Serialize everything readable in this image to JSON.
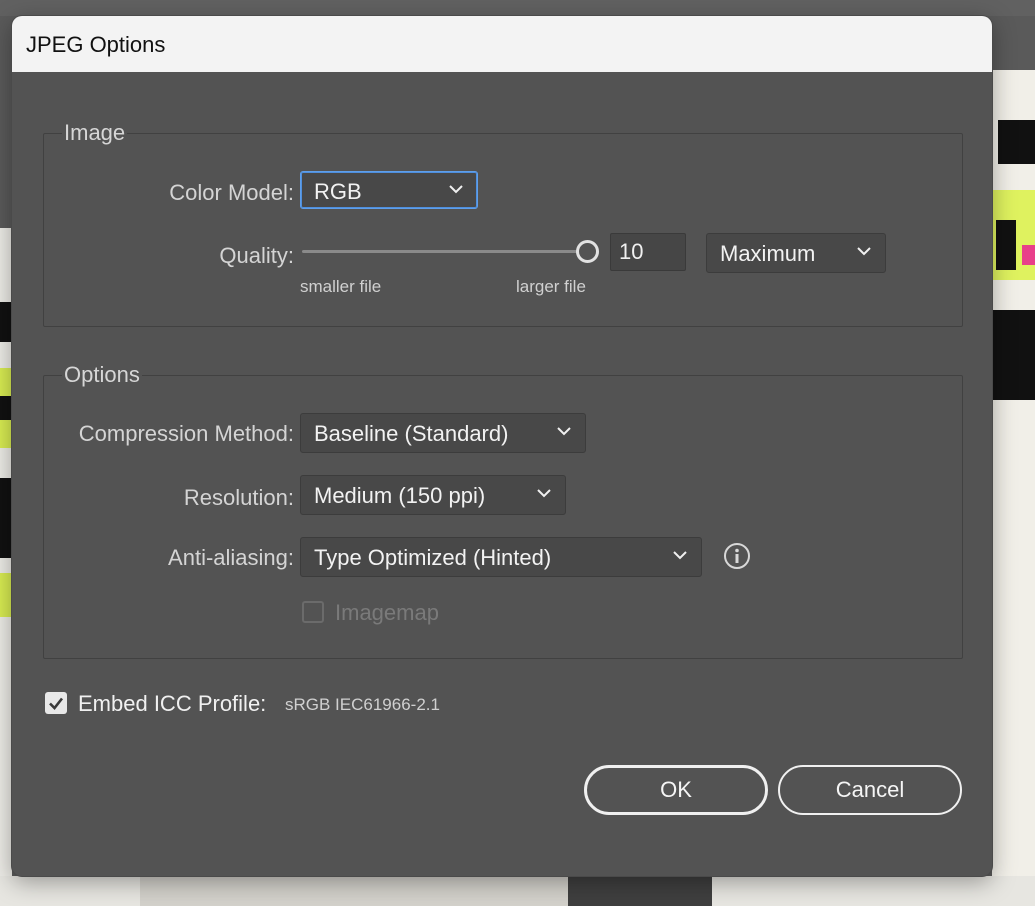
{
  "dialog": {
    "title": "JPEG Options",
    "image_group": {
      "legend": "Image",
      "color_model": {
        "label": "Color Model:",
        "value": "RGB"
      },
      "quality": {
        "label": "Quality:",
        "value": "10",
        "level_fraction": 1.0,
        "preset": "Maximum",
        "min_caption": "smaller file",
        "max_caption": "larger file"
      }
    },
    "options_group": {
      "legend": "Options",
      "compression": {
        "label": "Compression Method:",
        "value": "Baseline (Standard)"
      },
      "resolution": {
        "label": "Resolution:",
        "value": "Medium (150 ppi)"
      },
      "anti_aliasing": {
        "label": "Anti-aliasing:",
        "value": "Type Optimized (Hinted)"
      },
      "imagemap": {
        "label": "Imagemap",
        "checked": false,
        "disabled": true
      }
    },
    "embed_icc": {
      "label": "Embed ICC Profile:",
      "profile": "sRGB IEC61966-2.1",
      "checked": true
    },
    "buttons": {
      "ok": "OK",
      "cancel": "Cancel"
    }
  },
  "icons": {
    "chevron": "chevron-down-icon",
    "info": "info-icon",
    "check": "checkmark-icon"
  },
  "colors": {
    "dialog_bg": "#535353",
    "focus_ring": "#5f9fea",
    "title_bar": "#f3f3f3"
  }
}
